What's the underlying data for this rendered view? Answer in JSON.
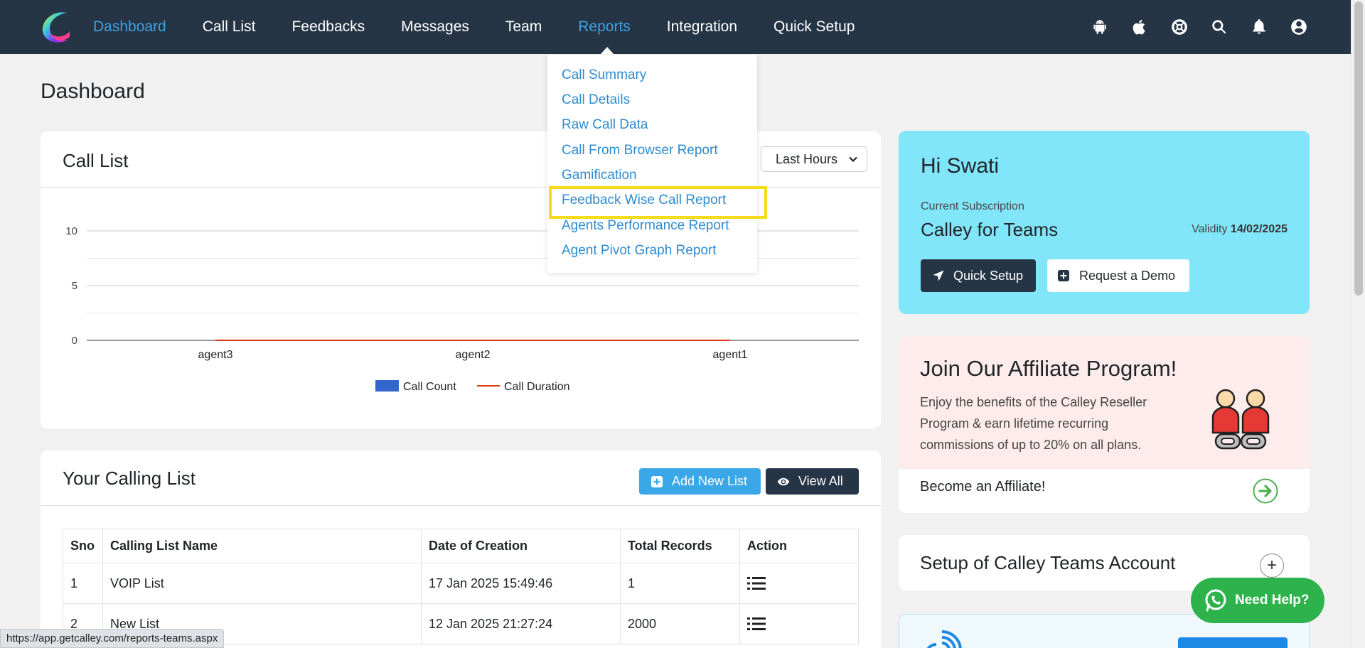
{
  "nav": {
    "items": [
      {
        "label": "Dashboard",
        "active": true
      },
      {
        "label": "Call List",
        "active": false
      },
      {
        "label": "Feedbacks",
        "active": false
      },
      {
        "label": "Messages",
        "active": false
      },
      {
        "label": "Team",
        "active": false
      },
      {
        "label": "Reports",
        "active": true
      },
      {
        "label": "Integration",
        "active": false
      },
      {
        "label": "Quick Setup",
        "active": false
      }
    ],
    "icons": [
      "android-icon",
      "apple-icon",
      "support-icon",
      "search-icon",
      "bell-icon",
      "user-icon"
    ]
  },
  "reports_menu": {
    "items": [
      "Call Summary",
      "Call Details",
      "Raw Call Data",
      "Call From Browser Report",
      "Gamification",
      "Feedback Wise Call Report",
      "Agents Performance Report",
      "Agent Pivot Graph Report"
    ],
    "highlighted_index": 5
  },
  "page": {
    "title": "Dashboard"
  },
  "call_list_card": {
    "title": "Call List",
    "period_select": "Last Hours"
  },
  "chart_data": {
    "type": "bar",
    "categories": [
      "agent3",
      "agent2",
      "agent1"
    ],
    "series": [
      {
        "name": "Call Count",
        "type": "bar",
        "color": "#3366cc",
        "values": [
          0,
          0,
          0
        ]
      },
      {
        "name": "Call Duration",
        "type": "line",
        "color": "#dc3912",
        "values": [
          0,
          0,
          0
        ]
      }
    ],
    "yticks": [
      0,
      5,
      10
    ],
    "ylim": [
      0,
      10
    ],
    "legend_position": "bottom",
    "grid": true
  },
  "calling_list": {
    "title": "Your Calling List",
    "add_label": "Add New List",
    "view_label": "View All",
    "columns": [
      "Sno",
      "Calling List Name",
      "Date of Creation",
      "Total Records",
      "Action"
    ],
    "rows": [
      {
        "sno": "1",
        "name": "VOIP List",
        "date": "17 Jan 2025 15:49:46",
        "records": "1"
      },
      {
        "sno": "2",
        "name": "New List",
        "date": "12 Jan 2025 21:27:24",
        "records": "2000"
      }
    ]
  },
  "welcome": {
    "greeting": "Hi Swati",
    "sub_label": "Current Subscription",
    "plan": "Calley for Teams",
    "validity_label": "Validity",
    "validity_date": "14/02/2025",
    "quick_setup": "Quick Setup",
    "request_demo": "Request a Demo"
  },
  "affiliate": {
    "title": "Join Our Affiliate Program!",
    "description": "Enjoy the benefits of the Calley Reseller Program & earn lifetime recurring commissions of up to 20% on all plans.",
    "link": "Become an Affiliate!"
  },
  "setup": {
    "title": "Setup of Calley Teams Account"
  },
  "whatsapp": {
    "label": "Need Help?"
  },
  "status_url": "https://app.getcalley.com/reports-teams.aspx",
  "colors": {
    "nav_bg": "#263545",
    "accent": "#3ea0e4",
    "welcome_bg": "#81e6f9",
    "affiliate_bg": "#fdeceb",
    "highlight": "#f5dc1a"
  }
}
